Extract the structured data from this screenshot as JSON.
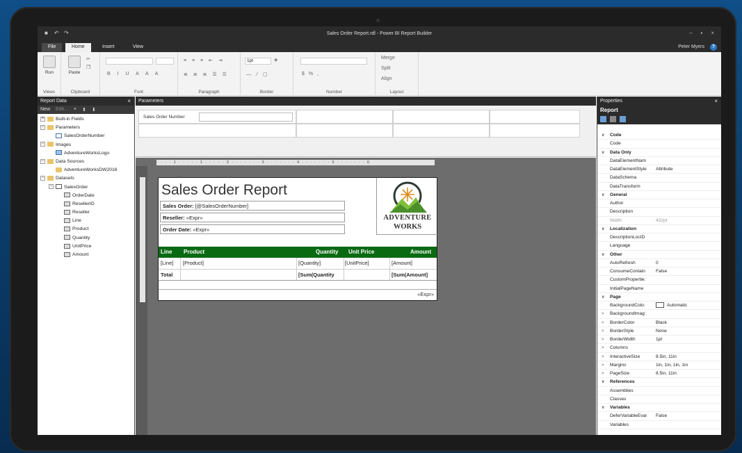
{
  "window": {
    "title": "Sales Order Report.rdl - Power BI Report Builder",
    "user": "Peter Myers",
    "help": "?"
  },
  "ribbon": {
    "tabs": [
      "File",
      "Home",
      "Insert",
      "View"
    ],
    "groups": {
      "views": "Views",
      "clipboard": "Clipboard",
      "font": "Font",
      "paragraph": "Paragraph",
      "border": "Border",
      "number": "Number",
      "layout": "Layout"
    },
    "run_label": "Run",
    "paste_label": "Paste",
    "border_width": "1pt",
    "merge_label": "Merge",
    "split_label": "Split",
    "align_label": "Align",
    "number_format": "$ % ,"
  },
  "report_data": {
    "title": "Report Data",
    "toolbar": {
      "new": "New",
      "edit": "Edit..."
    },
    "tree": [
      {
        "label": "Built-in Fields",
        "level": 0,
        "type": "folder",
        "exp": "+"
      },
      {
        "label": "Parameters",
        "level": 0,
        "type": "folder",
        "exp": "−"
      },
      {
        "label": "SalesOrderNumber",
        "level": 1,
        "type": "param"
      },
      {
        "label": "Images",
        "level": 0,
        "type": "folder",
        "exp": "−"
      },
      {
        "label": "AdventureWorksLogo",
        "level": 1,
        "type": "img"
      },
      {
        "label": "Data Sources",
        "level": 0,
        "type": "folder",
        "exp": "−"
      },
      {
        "label": "AdventureWorksDW2016",
        "level": 1,
        "type": "db"
      },
      {
        "label": "Datasets",
        "level": 0,
        "type": "folder",
        "exp": "−"
      },
      {
        "label": "SalesOrder",
        "level": 1,
        "type": "tbl",
        "exp": "−"
      },
      {
        "label": "OrderDate",
        "level": 2,
        "type": "fld"
      },
      {
        "label": "ResellerID",
        "level": 2,
        "type": "fld"
      },
      {
        "label": "Reseller",
        "level": 2,
        "type": "fld"
      },
      {
        "label": "Line",
        "level": 2,
        "type": "fld"
      },
      {
        "label": "Product",
        "level": 2,
        "type": "fld"
      },
      {
        "label": "Quantity",
        "level": 2,
        "type": "fld"
      },
      {
        "label": "UnitPrice",
        "level": 2,
        "type": "fld"
      },
      {
        "label": "Amount",
        "level": 2,
        "type": "fld"
      }
    ]
  },
  "parameters": {
    "title": "Parameters",
    "label": "Sales Order Number"
  },
  "ruler": "· · · · 1 · · · · · 1 · · · · · 2 · · · · · · · 3 · · · · · · · 4 · · · · · · · 5 · · · · · · · 6",
  "report": {
    "title": "Sales Order Report",
    "sales_order_label": "Sales Order:",
    "sales_order_value": "[@SalesOrderNumber]",
    "reseller_label": "Reseller:",
    "reseller_value": "«Expr»",
    "order_date_label": "Order Date:",
    "order_date_value": "«Expr»",
    "logo_line1": "ADVENTURE",
    "logo_line2": "WORKS",
    "columns": [
      "Line",
      "Product",
      "Quantity",
      "Unit Price",
      "Amount"
    ],
    "row": [
      "[Line]",
      "[Product]",
      "[Quantity]",
      "[UnitPrice]",
      "[Amount]"
    ],
    "total": [
      "Total",
      "[Sum(Quantity",
      "[Sum(Amount]"
    ],
    "footer": "«Expr»",
    "colors": {
      "header_bg": "#0a6a12"
    }
  },
  "properties": {
    "title": "Properties",
    "object": "Report",
    "rows": [
      {
        "cat": true,
        "name": "Code",
        "c": "∨"
      },
      {
        "name": "Code",
        "value": ""
      },
      {
        "cat": true,
        "name": "Data Only",
        "c": "∨"
      },
      {
        "name": "DataElementNam",
        "value": ""
      },
      {
        "name": "DataElementStyle",
        "value": "Attribute"
      },
      {
        "name": "DataSchema",
        "value": ""
      },
      {
        "name": "DataTransform",
        "value": ""
      },
      {
        "cat": true,
        "name": "General",
        "c": "∨"
      },
      {
        "name": "Author",
        "value": ""
      },
      {
        "name": "Description",
        "value": ""
      },
      {
        "name": "Width",
        "value": "432pt",
        "dim": true
      },
      {
        "cat": true,
        "name": "Localization",
        "c": "∨"
      },
      {
        "name": "DescriptionLocID",
        "value": ""
      },
      {
        "name": "Language",
        "value": ""
      },
      {
        "cat": true,
        "name": "Other",
        "c": "∨"
      },
      {
        "name": "AutoRefresh",
        "value": "0"
      },
      {
        "name": "ConsumeContain",
        "value": "False"
      },
      {
        "name": "CustomPropertie:",
        "value": ""
      },
      {
        "name": "InitialPageName",
        "value": ""
      },
      {
        "cat": true,
        "name": "Page",
        "c": "∨"
      },
      {
        "name": "BackgroundColo:",
        "value": "Automatic",
        "swatch": true
      },
      {
        "name": "BackgroundImag:",
        "value": "",
        "c": ">"
      },
      {
        "name": "BorderColor",
        "value": "Black",
        "c": ">"
      },
      {
        "name": "BorderStyle",
        "value": "None",
        "c": ">"
      },
      {
        "name": "BorderWidth",
        "value": "1pt",
        "c": ">"
      },
      {
        "name": "Columns",
        "value": "",
        "c": ">"
      },
      {
        "name": "InteractiveSize",
        "value": "8.5in, 11in",
        "c": ">"
      },
      {
        "name": "Margins",
        "value": "1in, 1in, 1in, 1in",
        "c": ">"
      },
      {
        "name": "PageSize",
        "value": "8.5in, 11in",
        "c": ">"
      },
      {
        "cat": true,
        "name": "References",
        "c": "∨"
      },
      {
        "name": "Assemblies",
        "value": ""
      },
      {
        "name": "Classes",
        "value": ""
      },
      {
        "cat": true,
        "name": "Variables",
        "c": "∨"
      },
      {
        "name": "DeferVariableEval",
        "value": "False"
      },
      {
        "name": "Variables",
        "value": ""
      }
    ]
  }
}
